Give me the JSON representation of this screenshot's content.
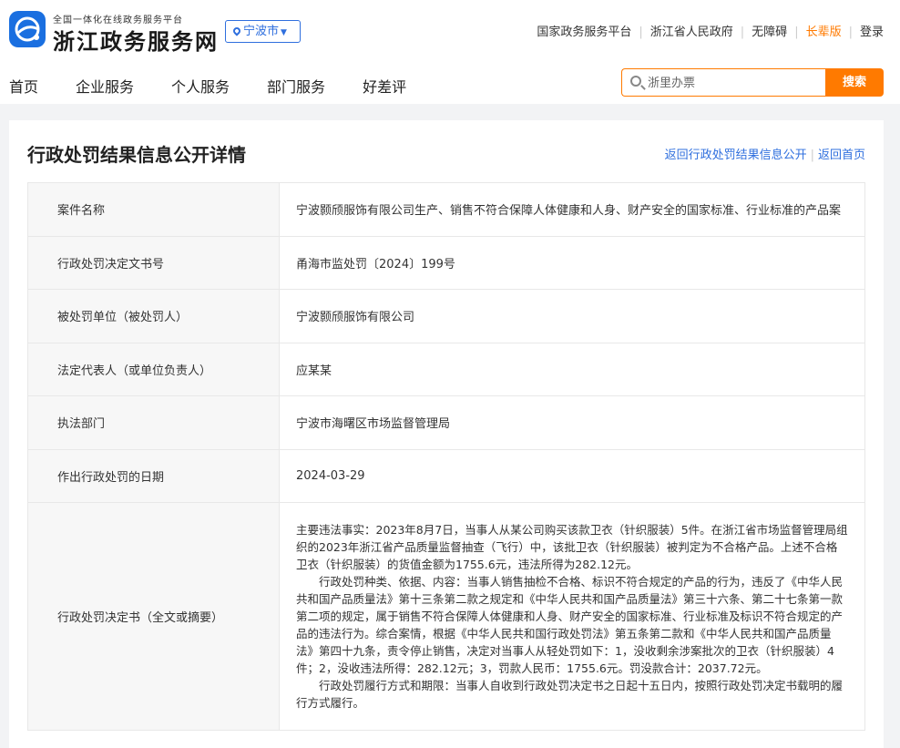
{
  "header": {
    "brand_sub": "全国一体化在线政务服务平台",
    "brand_main": "浙江政务服务网",
    "city": "宁波市",
    "top_links": [
      "国家政务服务平台",
      "浙江省人民政府",
      "无障碍"
    ],
    "elder_mode": "长辈版",
    "login": "登录"
  },
  "nav": [
    "首页",
    "企业服务",
    "个人服务",
    "部门服务",
    "好差评"
  ],
  "search": {
    "placeholder": "浙里办票",
    "button": "搜索"
  },
  "page": {
    "title": "行政处罚结果信息公开详情",
    "back_list": "返回行政处罚结果信息公开",
    "back_home": "返回首页"
  },
  "details": {
    "rows": [
      {
        "label": "案件名称",
        "value": "宁波颢颀服饰有限公司生产、销售不符合保障人体健康和人身、财产安全的国家标准、行业标准的产品案"
      },
      {
        "label": "行政处罚决定文书号",
        "value": "甬海市监处罚〔2024〕199号"
      },
      {
        "label": "被处罚单位（被处罚人）",
        "value": "宁波颢颀服饰有限公司"
      },
      {
        "label": "法定代表人（或单位负责人）",
        "value": "应某某"
      },
      {
        "label": "执法部门",
        "value": "宁波市海曙区市场监督管理局"
      },
      {
        "label": "作出行政处罚的日期",
        "value": "2024-03-29"
      }
    ],
    "decision": {
      "label": "行政处罚决定书（全文或摘要）",
      "p1": "主要违法事实：2023年8月7日，当事人从某公司购买该款卫衣（针织服装）5件。在浙江省市场监督管理局组织的2023年浙江省产品质量监督抽查（飞行）中，该批卫衣（针织服装）被判定为不合格产品。上述不合格卫衣（针织服装）的货值金额为1755.6元，违法所得为282.12元。",
      "p2": "行政处罚种类、依据、内容：当事人销售抽检不合格、标识不符合规定的产品的行为，违反了《中华人民共和国产品质量法》第十三条第二款之规定和《中华人民共和国产品质量法》第三十六条、第二十七条第一款第二项的规定，属于销售不符合保障人体健康和人身、财产安全的国家标准、行业标准及标识不符合规定的产品的违法行为。综合案情，根据《中华人民共和国行政处罚法》第五条第二款和《中华人民共和国产品质量法》第四十九条，责令停止销售，决定对当事人从轻处罚如下：1，没收剩余涉案批次的卫衣（针织服装）4件；2，没收违法所得：282.12元；3，罚款人民币：1755.6元。罚没款合计：2037.72元。",
      "p3": "行政处罚履行方式和期限：当事人自收到行政处罚决定书之日起十五日内，按照行政处罚决定书载明的履行方式履行。"
    }
  },
  "colors": {
    "accent": "#ff7a00",
    "link": "#2f6fde",
    "logo": "#1a6fe0"
  }
}
